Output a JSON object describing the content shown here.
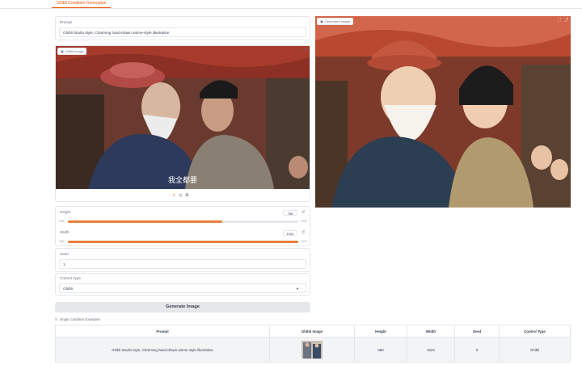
{
  "tab": {
    "label": "Ghibli Condition Generation"
  },
  "prompt": {
    "label": "Prompt",
    "value": "Ghibli Studio style, Charming hand-drawn anime-style illustration"
  },
  "input_image": {
    "label": "Ghibli Image",
    "subtitle": "我全都要"
  },
  "output_image": {
    "label": "Generated Image"
  },
  "height": {
    "label": "Height",
    "value": "768",
    "min": "256",
    "max": "1024",
    "fraction": 0.67
  },
  "width": {
    "label": "Width",
    "value": "1024",
    "min": "256",
    "max": "1024",
    "fraction": 1.0
  },
  "seed": {
    "label": "Seed",
    "value": "1"
  },
  "control": {
    "label": "Control Type",
    "value": "Ghibli"
  },
  "generate": {
    "label": "Generate Image"
  },
  "examples": {
    "label": "Single Condition Examples",
    "headers": [
      "Prompt",
      "Ghibli Image",
      "Height",
      "Width",
      "Seed",
      "Control Type"
    ],
    "row": {
      "prompt": "Ghibli Studio style, Charming hand-drawn anime-style illustration",
      "height": "680",
      "width": "1024",
      "seed": "5",
      "control": "Ghibli"
    }
  },
  "colors": {
    "accent": "#e8803a",
    "tab": "#ea580c"
  }
}
